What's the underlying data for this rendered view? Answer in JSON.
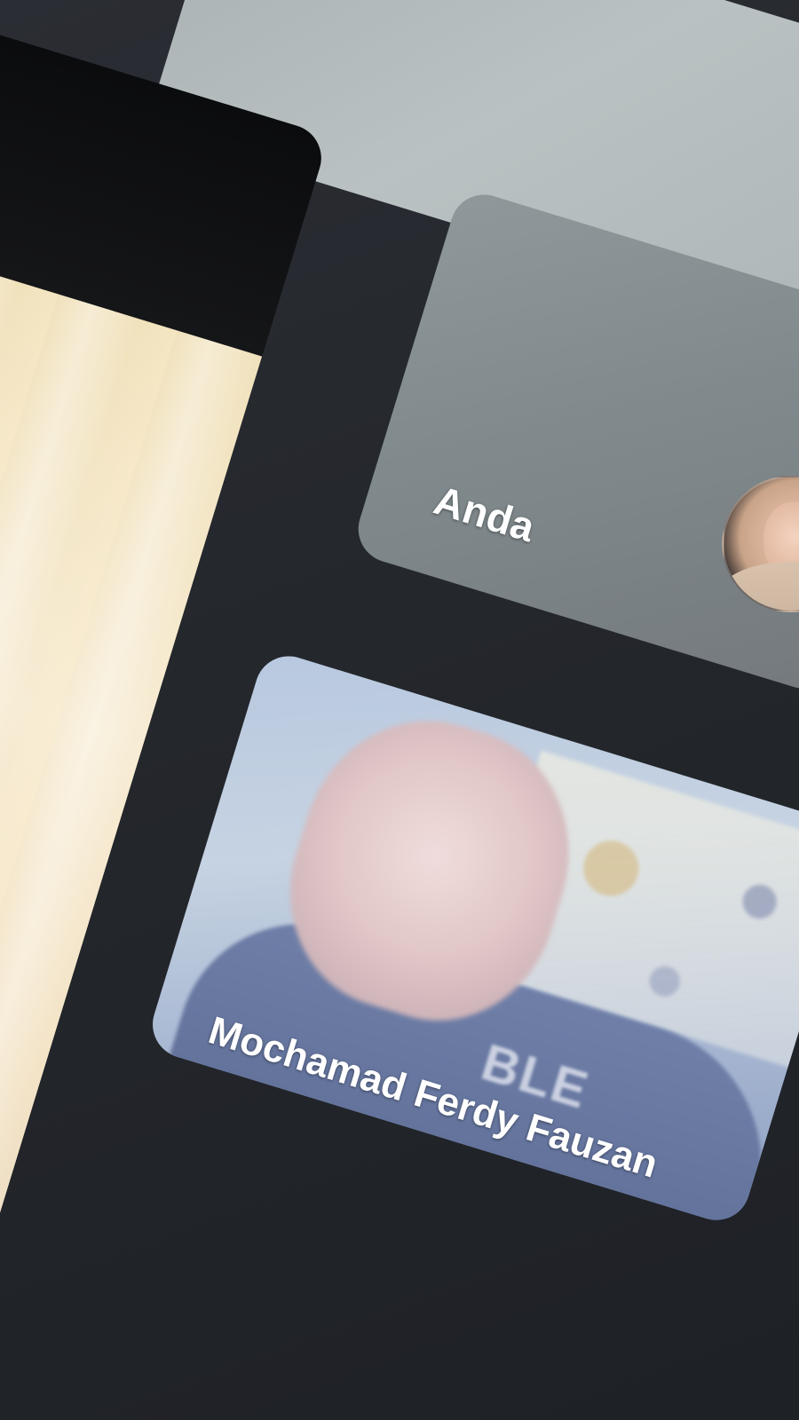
{
  "meeting": {
    "participants": [
      {
        "name": "Anda"
      },
      {
        "name": "Mochamad Ferdy Fauzan"
      }
    ],
    "remote_video_shirt_text": "BLE"
  }
}
